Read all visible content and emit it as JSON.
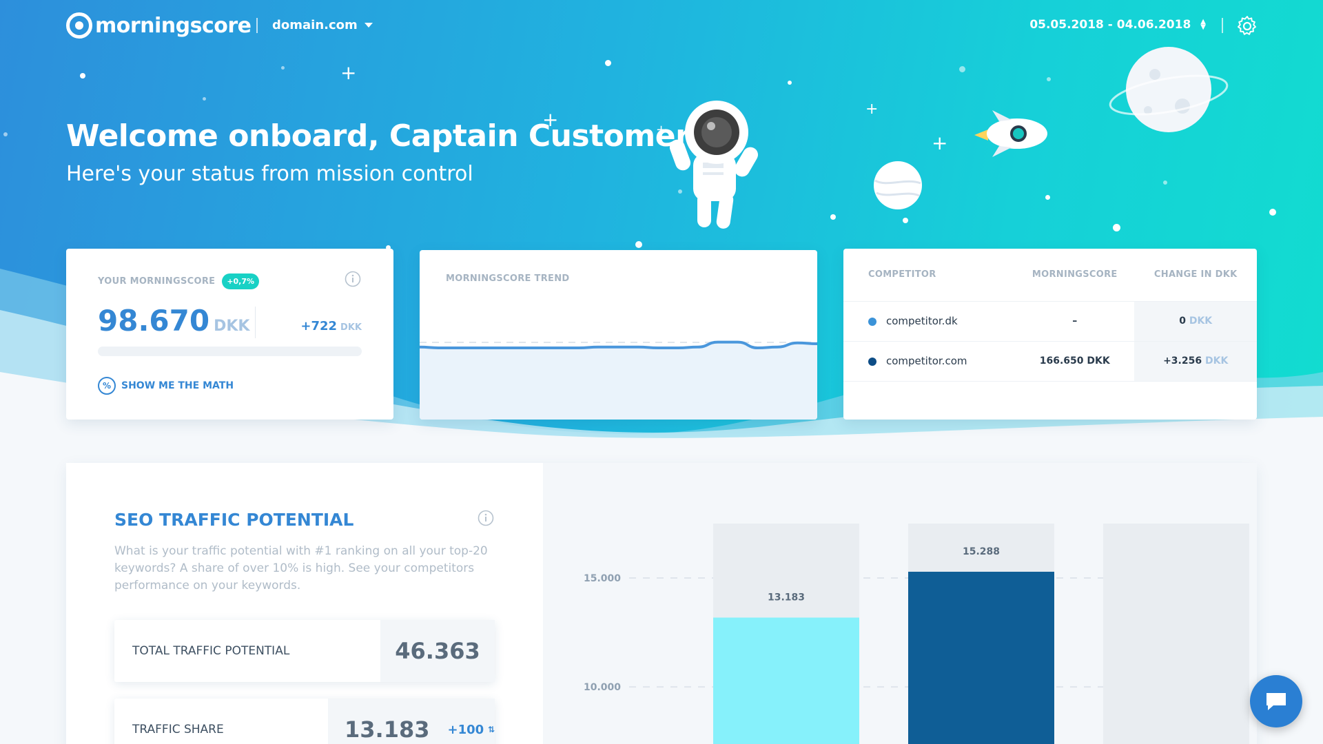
{
  "brand": {
    "name": "morningscore"
  },
  "header": {
    "domain": "domain.com",
    "date_range": "05.05.2018 - 04.06.2018"
  },
  "hero": {
    "title": "Welcome onboard, Captain Customer",
    "subtitle": "Here's your status from mission control"
  },
  "score_card": {
    "label": "YOUR MORNINGSCORE",
    "badge": "+0,7%",
    "value": "98.670",
    "unit": "DKK",
    "delta": "+722",
    "delta_unit": "DKK",
    "link": "SHOW ME THE MATH",
    "link_icon": "%",
    "progress_percent": 0
  },
  "trend_card": {
    "title": "MORNINGSCORE TREND",
    "trend_values": [
      66,
      65,
      65,
      65,
      65,
      65,
      65,
      65,
      65,
      66,
      66,
      66,
      65,
      65,
      66,
      72,
      72,
      65,
      66,
      71,
      70
    ]
  },
  "competitor_table": {
    "headers": [
      "COMPETITOR",
      "MORNINGSCORE",
      "CHANGE IN DKK"
    ],
    "rows": [
      {
        "name": "competitor.dk",
        "score": "–",
        "change": "0",
        "change_unit": "DKK",
        "color": "#3b93d8"
      },
      {
        "name": "competitor.com",
        "score": "166.650 DKK",
        "change": "+3.256",
        "change_unit": "DKK",
        "color": "#0d4d86"
      }
    ]
  },
  "seo": {
    "title": "SEO TRAFFIC POTENTIAL",
    "description": "What is your traffic potential with #1 ranking on all your top-20 keywords? A share of over 10% is high. See your competitors performance on your keywords.",
    "total_label": "TOTAL TRAFFIC POTENTIAL",
    "total_value": "46.363",
    "share_label": "TRAFFIC SHARE",
    "share_value": "13.183",
    "share_delta": "+100"
  },
  "chart_data": {
    "type": "bar",
    "categories": [
      "",
      "",
      ""
    ],
    "values": [
      13183,
      15288,
      null
    ],
    "data_labels": [
      "13.183",
      "15.288",
      ""
    ],
    "colors": [
      "#86f1fb",
      "#0f5e96",
      "#e9edf1"
    ],
    "y_ticks": [
      "15.000",
      "10.000"
    ],
    "ylim_visible": [
      7000,
      17500
    ]
  },
  "colors": {
    "primary": "#3487d4",
    "accent_teal": "#18d1c5",
    "hero_from": "#2d8fdc",
    "hero_to": "#12dcd0"
  }
}
